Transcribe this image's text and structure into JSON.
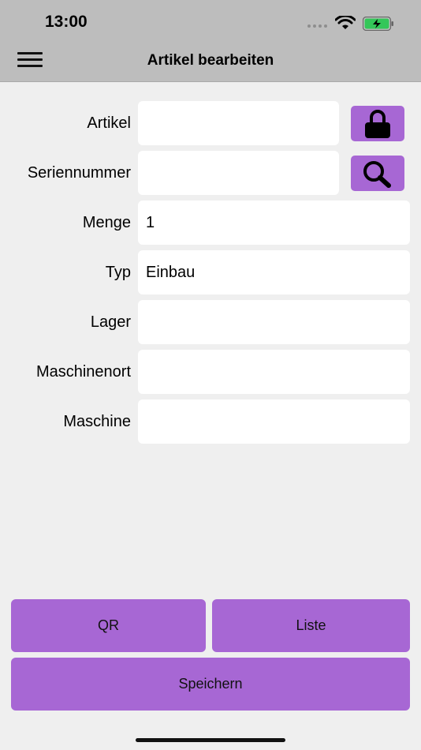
{
  "status": {
    "time": "13:00"
  },
  "nav": {
    "title": "Artikel bearbeiten"
  },
  "form": {
    "artikel": {
      "label": "Artikel",
      "value": ""
    },
    "seriennummer": {
      "label": "Seriennummer",
      "value": ""
    },
    "menge": {
      "label": "Menge",
      "value": "1"
    },
    "typ": {
      "label": "Typ",
      "value": "Einbau"
    },
    "lager": {
      "label": "Lager",
      "value": ""
    },
    "maschinenort": {
      "label": "Maschinenort",
      "value": ""
    },
    "maschine": {
      "label": "Maschine",
      "value": ""
    }
  },
  "buttons": {
    "qr": "QR",
    "liste": "Liste",
    "speichern": "Speichern"
  },
  "icons": {
    "lock": "lock-icon",
    "search": "search-icon",
    "menu": "hamburger-menu-icon"
  },
  "colors": {
    "accent": "#a767d4",
    "bar": "#bdbdbd",
    "background": "#efefef"
  }
}
